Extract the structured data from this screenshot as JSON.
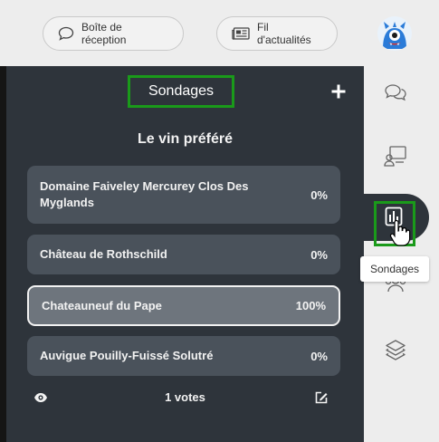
{
  "header": {
    "inbox_label": "Boîte de réception",
    "feed_label": "Fil d'actualités"
  },
  "panel": {
    "title": "Sondages",
    "question": "Le vin préféré",
    "options": [
      {
        "label": "Domaine Faiveley Mercurey Clos Des Myglands",
        "percent": "0%"
      },
      {
        "label": "Château de Rothschild",
        "percent": "0%"
      },
      {
        "label": "Chateauneuf du Pape",
        "percent": "100%",
        "selected": true
      },
      {
        "label": "Auvigue Pouilly-Fuissé Solutré",
        "percent": "0%"
      }
    ],
    "votes": "1 votes"
  },
  "sidebar": {
    "tooltip": "Sondages",
    "items": [
      "chat-icon",
      "presentation-icon",
      "poll-icon",
      "users-icon",
      "layers-icon"
    ]
  },
  "colors": {
    "panel_bg": "#2e343b",
    "option_bg": "#4a525b",
    "selected_bg": "#6e757d",
    "highlight_green": "#1a9a1a",
    "page_bg": "#ededed"
  }
}
